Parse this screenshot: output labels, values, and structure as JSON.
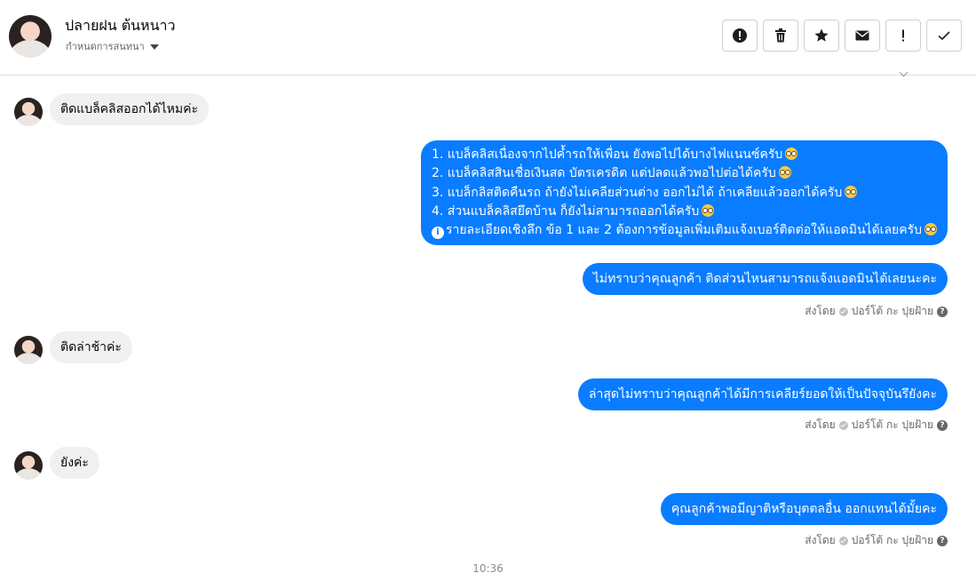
{
  "header": {
    "name": "ปลายฝน ต้นหนาว",
    "subtitle": "กำหนดการสนทนา"
  },
  "toolbar": {
    "icons": [
      "alert-circle-icon",
      "trash-icon",
      "star-icon",
      "mail-icon",
      "exclamation-icon",
      "check-icon"
    ]
  },
  "messages": {
    "m1": "ติดแบล็คลิสออกได้ไหมค่ะ",
    "m2_lines": [
      "1. แบล็คลิสเนื่องจากไปค้ำรถให้เพื่อน ยังพอไปได้บางไฟแนนซ์ครับ",
      "2. แบล็คลิสสินเชื่อเงินสด บัตรเครดิต แต่ปลดแล้วพอไปต่อได้ครับ",
      "3. แบล็กลิสติดคืนรถ ถ้ายังไม่เคลียส่วนต่าง ออกไม่ได้ ถ้าเคลียแล้วออกได้ครับ",
      "4. ส่วนแบล็คลิสยึดบ้าน ก็ยังไม่สามารถออกได้ครับ",
      "รายละเอียดเชิงลึก ข้อ 1 และ 2 ต้องการข้อมูลเพิ่มเติมแจ้งเบอร์ติดต่อให้แอดมินได้เลยครับ"
    ],
    "m3": "ไม่ทราบว่าคุณลูกค้า ติดส่วนไหนสามารถแจ้งแอดมินได้เลยนะคะ",
    "m4": "ติดล่าช้าค่ะ",
    "m5": "ล่าสุดไม่ทราบว่าคุณลูกค้าได้มีการเคลียร์ยอดให้เป็นปัจจุบันรึยังคะ",
    "m6": "ยังค่ะ",
    "m7": "คุณลูกค้าพอมีญาติหรือบุตตลอื่น ออกแทนได้มั้ยคะ"
  },
  "sent_by": {
    "prefix": "ส่งโดย",
    "agent": "ปอร์โต้ กะ ปุยฝ้าย"
  },
  "timestamp": "10:36",
  "colors": {
    "outgoing_bubble": "#0a7cff",
    "incoming_bubble": "#f0f0f0"
  }
}
